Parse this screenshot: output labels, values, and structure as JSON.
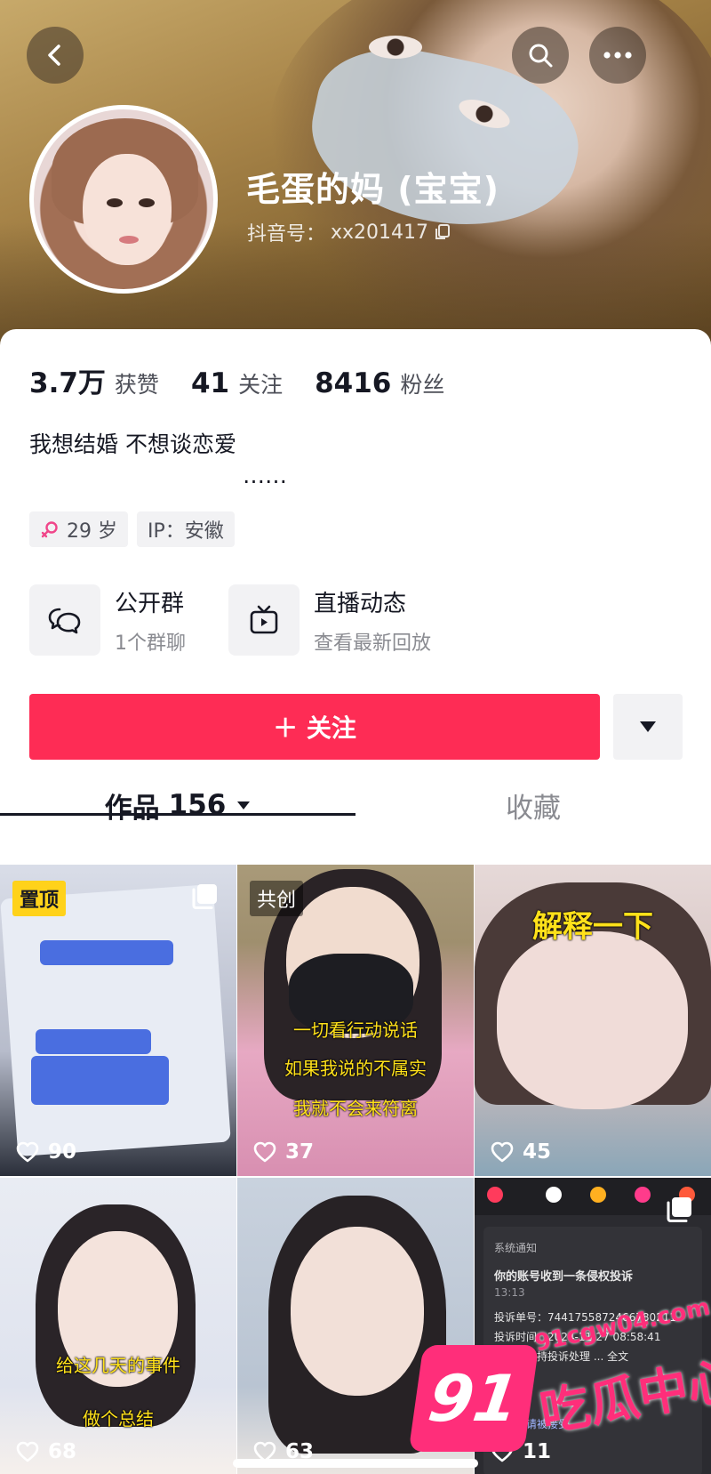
{
  "header": {
    "nickname": "毛蛋的妈 (宝宝)",
    "douyin_id_label": "抖音号：",
    "douyin_id_value": "xx201417",
    "icons": [
      "back-arrow-icon",
      "search-icon",
      "more-dots-icon",
      "copy-icon"
    ]
  },
  "stats": [
    {
      "value": "3.7万",
      "label": "获赞"
    },
    {
      "value": "41",
      "label": "关注"
    },
    {
      "value": "8416",
      "label": "粉丝"
    }
  ],
  "bio": {
    "text": "我想结婚 不想谈恋爱",
    "more": "……"
  },
  "tags": {
    "gender_icon": "female-symbol-icon",
    "age": "29 岁",
    "ip": "IP：安徽"
  },
  "entries": [
    {
      "title": "公开群",
      "subtitle": "1个群聊",
      "icon": "group-chat-icon"
    },
    {
      "title": "直播动态",
      "subtitle": "查看最新回放",
      "icon": "tv-icon"
    }
  ],
  "actions": {
    "follow_label": "＋ 关注",
    "more_icon": "caret-down-icon"
  },
  "tabs": {
    "works_label": "作品",
    "works_count": "156",
    "favorites_label": "收藏"
  },
  "grid": [
    {
      "likes": "90",
      "badge": "置顶",
      "multi_image": true
    },
    {
      "likes": "37",
      "badge": "共创",
      "captions": [
        "一切看行动说话",
        "如果我说的不属实",
        "我就不会来符离"
      ]
    },
    {
      "likes": "45",
      "title_overlay": "解释一下"
    },
    {
      "likes": "68",
      "captions": [
        "给这几天的事件",
        "做个总结"
      ]
    },
    {
      "likes": "63"
    },
    {
      "likes": "11",
      "multi_image": true,
      "screen_text": {
        "notice": "系统通知",
        "headline": "你的账号收到一条侵权投诉",
        "time_short": "13:13",
        "case_no": "投诉单号：7441755872466780211",
        "case_time": "投诉时间：2024-11-27 08:58:41",
        "status": "状态：支持投诉处理 ... 全文",
        "footer": "共创邀请被接受"
      }
    }
  ],
  "watermark": {
    "url": "91cgw04.com",
    "logo": "91",
    "name": "吃瓜中心"
  },
  "colors": {
    "accent": "#fe2c55",
    "text_primary": "#161823",
    "text_secondary": "#8a8b91",
    "watermark": "#ff2e7a",
    "pin_badge": "#ffd21a"
  }
}
